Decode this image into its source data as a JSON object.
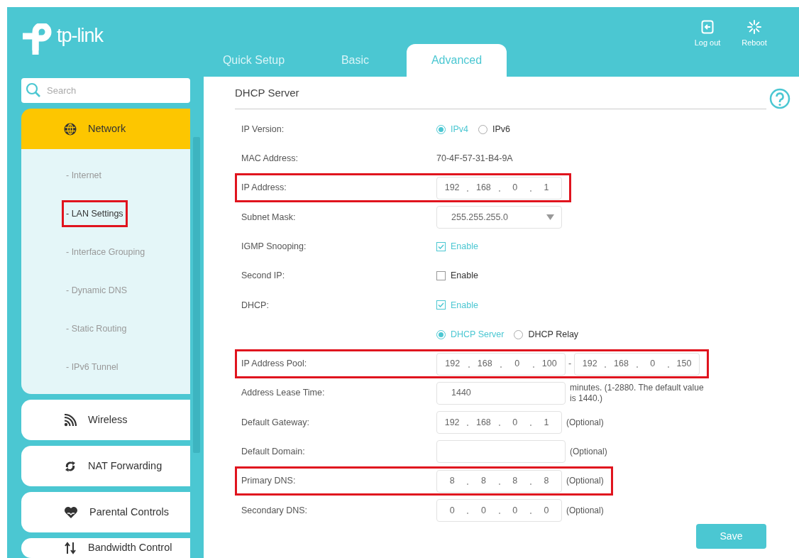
{
  "header": {
    "logo": "tp-link",
    "tabs": [
      {
        "label": "Quick Setup",
        "selected": false
      },
      {
        "label": "Basic",
        "selected": false
      },
      {
        "label": "Advanced",
        "selected": true
      }
    ],
    "actions": [
      {
        "kind": "logout",
        "label": "Log out"
      },
      {
        "kind": "reboot",
        "label": "Reboot"
      }
    ]
  },
  "sidebar": {
    "search": {
      "placeholder": "Search"
    },
    "items": [
      {
        "kind": "globe",
        "label": "Network",
        "selected": true,
        "expanded": true,
        "children": [
          {
            "label": "- Internet",
            "selected": false,
            "highlighted": false
          },
          {
            "label": "- LAN Settings",
            "selected": true,
            "highlighted": true
          },
          {
            "label": "- Interface Grouping",
            "selected": false,
            "highlighted": false
          },
          {
            "label": "- Dynamic DNS",
            "selected": false,
            "highlighted": false
          },
          {
            "label": "- Static Routing",
            "selected": false,
            "highlighted": false
          },
          {
            "label": "- IPv6 Tunnel",
            "selected": false,
            "highlighted": false
          }
        ]
      },
      {
        "kind": "wifi",
        "label": "Wireless",
        "selected": false,
        "expanded": false
      },
      {
        "kind": "cycle",
        "label": "NAT Forwarding",
        "selected": false,
        "expanded": false
      },
      {
        "kind": "heart",
        "label": "Parental Controls",
        "selected": false,
        "expanded": false
      },
      {
        "kind": "updown",
        "label": "Bandwidth Control",
        "selected": false,
        "expanded": false
      }
    ]
  },
  "panel": {
    "title": "DHCP Server",
    "rows": [
      {
        "kind": "radio",
        "label": "IP Version:",
        "highlighted": false,
        "options": [
          {
            "label": "IPv4",
            "selected": true
          },
          {
            "label": "IPv6",
            "selected": false
          }
        ]
      },
      {
        "kind": "text",
        "label": "MAC Address:",
        "highlighted": false,
        "value": "70-4F-57-31-B4-9A"
      },
      {
        "kind": "ip",
        "label": "IP Address:",
        "highlighted": true,
        "octets": [
          "192",
          "168",
          "0",
          "1"
        ]
      },
      {
        "kind": "select",
        "label": "Subnet Mask:",
        "highlighted": false,
        "value": "255.255.255.0"
      },
      {
        "kind": "checkbox",
        "label": "IGMP Snooping:",
        "highlighted": false,
        "checked": true,
        "option": "Enable"
      },
      {
        "kind": "checkbox",
        "label": "Second IP:",
        "highlighted": false,
        "checked": false,
        "option": "Enable"
      },
      {
        "kind": "checkbox",
        "label": "DHCP:",
        "highlighted": false,
        "checked": true,
        "option": "Enable"
      },
      {
        "kind": "radio",
        "highlighted": false,
        "options": [
          {
            "label": "DHCP Server",
            "selected": true
          },
          {
            "label": "DHCP Relay",
            "selected": false
          }
        ]
      },
      {
        "kind": "ip_range",
        "label": "IP Address Pool:",
        "highlighted": true,
        "from": [
          "192",
          "168",
          "0",
          "100"
        ],
        "separator": "-",
        "to": [
          "192",
          "168",
          "0",
          "150"
        ]
      },
      {
        "kind": "input",
        "label": "Address Lease Time:",
        "highlighted": false,
        "value": "1440",
        "note": "minutes. (1-2880. The default value is 1440.)"
      },
      {
        "kind": "ip",
        "label": "Default Gateway:",
        "highlighted": false,
        "octets": [
          "192",
          "168",
          "0",
          "1"
        ],
        "note": "(Optional)"
      },
      {
        "kind": "input",
        "label": "Default Domain:",
        "highlighted": false,
        "note": "(Optional)"
      },
      {
        "kind": "ip",
        "label": "Primary DNS:",
        "highlighted": true,
        "octets": [
          "8",
          "8",
          "8",
          "8"
        ],
        "note": "(Optional)"
      },
      {
        "kind": "ip",
        "label": "Secondary DNS:",
        "highlighted": false,
        "octets": [
          "0",
          "0",
          "0",
          "0"
        ],
        "note": "(Optional)"
      }
    ],
    "save": "Save"
  }
}
